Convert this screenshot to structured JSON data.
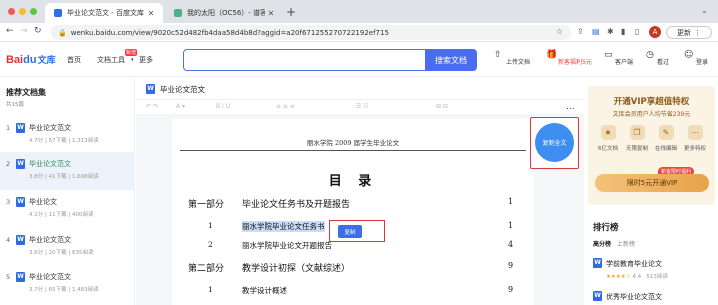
{
  "browser": {
    "tabs": [
      {
        "title": "毕业论文范文 - 百度文库",
        "active": true
      },
      {
        "title": "我的太阳（OC56）- 谱客巴巴",
        "active": false
      }
    ],
    "new_tab": "+",
    "url": "wenku.baidu.com/view/9020c52d482fb4daa58d4b8d?aggid=a20f6712552707221​92ef715",
    "update_label": "更新",
    "profile_initial": "A"
  },
  "header": {
    "logo_main": "Bai",
    "logo_paw": "du",
    "logo_wk": "文库",
    "nav": [
      "首页",
      "文档工具",
      "更多"
    ],
    "new_badge": "新增",
    "search_button": "搜索文档",
    "actions": [
      {
        "icon": "upload-icon",
        "label": "上传文档"
      },
      {
        "icon": "gift-icon",
        "label": "新客福利5元"
      },
      {
        "icon": "client-icon",
        "label": "客户端"
      },
      {
        "icon": "history-icon",
        "label": "看过"
      },
      {
        "icon": "user-icon",
        "label": "登录"
      }
    ]
  },
  "sidebar": {
    "title": "推荐文档集",
    "count": "共15篇",
    "items": [
      {
        "num": "1",
        "name": "毕业论文范文",
        "meta": "4.7分 | 57下载 | 1,313阅读"
      },
      {
        "num": "2",
        "name": "毕业论文范文",
        "meta": "3.8分 | 41下载 | 1,698阅读"
      },
      {
        "num": "3",
        "name": "毕业论文",
        "meta": "4.1分 | 11下载 | 400阅读"
      },
      {
        "num": "4",
        "name": "毕业论文范文",
        "meta": "3.6分 | 20下载 | 635阅读"
      },
      {
        "num": "5",
        "name": "毕业论文范文",
        "meta": "3.7分 | 65下载 | 1,483阅读"
      }
    ]
  },
  "document": {
    "title": "毕业论文范文",
    "page_header": "丽水学院 2009 届学生毕业论文",
    "toc_title": "目  录",
    "parts": [
      {
        "part": "第一部分",
        "title": "毕业论文任务书及开题报告",
        "page": "1"
      },
      {
        "part": "第二部分",
        "title": "教学设计初探（文献综述）",
        "page": "9"
      }
    ],
    "sub_items": [
      {
        "idx": "1",
        "title": "丽水学院毕业论文任务书",
        "page": "1"
      },
      {
        "idx": "2",
        "title": "丽水学院毕业论文开题报告",
        "page": "4"
      },
      {
        "idx": "1",
        "title": "教学设计概述",
        "page": "9"
      }
    ],
    "copy_label": "复制",
    "fulltext_label": "复制全文",
    "more": "..."
  },
  "vip": {
    "title": "开通VIP享超值特权",
    "subtitle_pre": "文库会员用户人均节省",
    "subtitle_hot": "239元",
    "features": [
      {
        "icon": "star-icon",
        "label": "6亿文档"
      },
      {
        "icon": "copy-icon",
        "label": "无限复制"
      },
      {
        "icon": "edit-icon",
        "label": "在线编辑"
      },
      {
        "icon": "more-icon",
        "label": "更多特权"
      }
    ],
    "tag": "新客限时福利",
    "button": "限时5元开通VIP"
  },
  "ranking": {
    "title": "排行榜",
    "tabs": [
      "高分榜",
      "上新榜"
    ],
    "items": [
      {
        "name": "学前教育毕业论文",
        "rating": "4.4",
        "reads": "513阅读"
      },
      {
        "name": "优秀毕业论文范文",
        "rating": "",
        "reads": ""
      }
    ]
  }
}
